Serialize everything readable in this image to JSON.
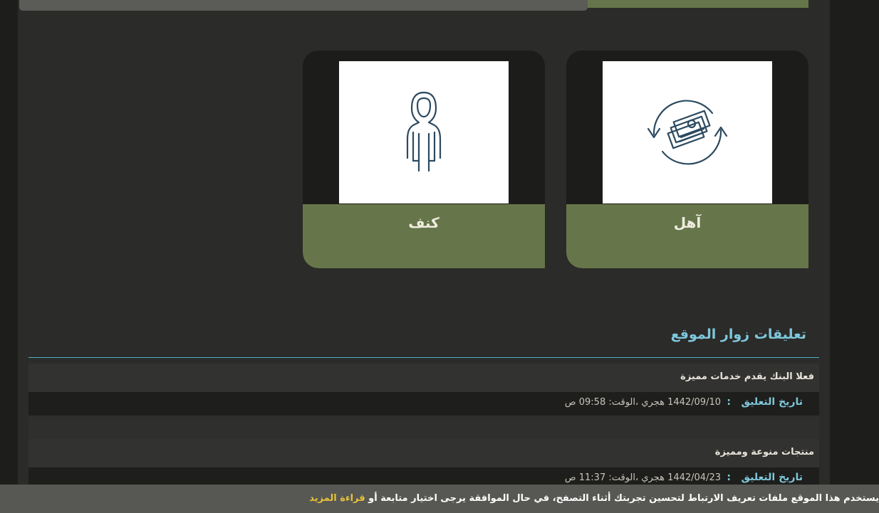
{
  "cards": [
    {
      "title": "آهل",
      "icon": "money-exchange-icon"
    },
    {
      "title": "كنف",
      "icon": "hijab-woman-icon"
    }
  ],
  "visitor_comments": {
    "title": "تعليقات زوار الموقع",
    "items": [
      {
        "text": "فعلا البنك يقدم خدمات مميزة",
        "date_label": "تاريخ التعليق",
        "separator": ":",
        "date_value": "1442/09/10 هجري ،الوقت: 09:58 ص"
      },
      {
        "text": "منتجات منوعة ومميزة",
        "date_label": "تاريخ التعليق",
        "separator": ":",
        "date_value": "1442/04/23 هجري ،الوقت: 11:37 ص"
      }
    ]
  },
  "cookie_bar": {
    "text": "يستخدم هذا الموقع ملفات تعريف الارتباط لتحسين تجربتك أثناء التصفح، في حال الموافقة يرجى اختيار متابعة أو",
    "read_more": "قراءة المزيد"
  },
  "colors": {
    "accent_green": "#66764a",
    "accent_cyan": "#7ec8dc",
    "link_yellow": "#e8c23a",
    "icon_blue": "#2c4a60"
  }
}
